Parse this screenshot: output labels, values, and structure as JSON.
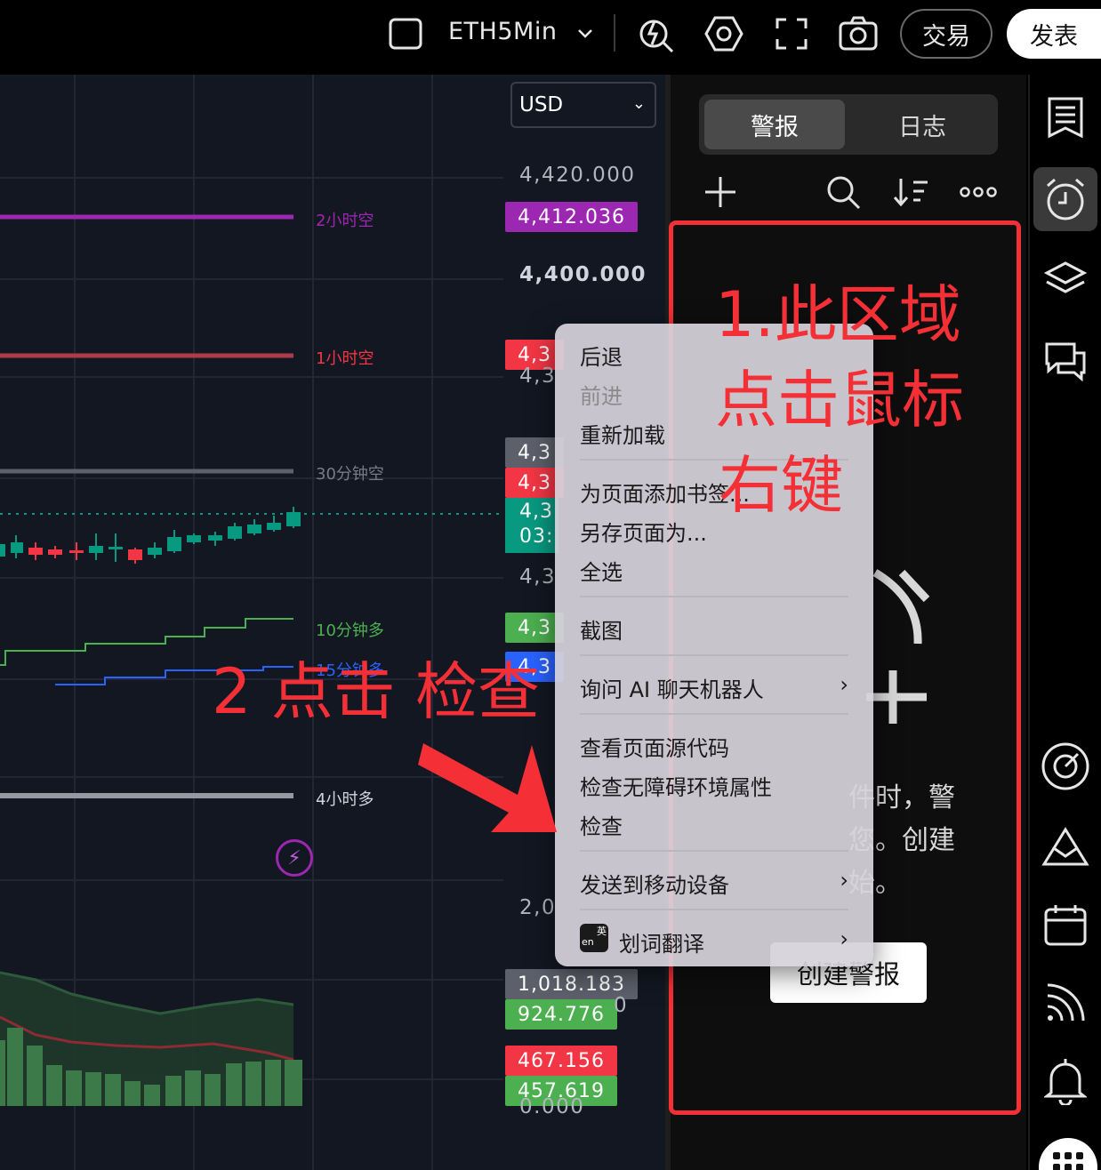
{
  "toolbar": {
    "symbol": "ETH5Min",
    "trade_label": "交易",
    "publish_label": "发表"
  },
  "chart": {
    "currency": "USD",
    "axis_ticks": {
      "t1": "4,420.000",
      "t2": "4,400.000",
      "t3": "4,3",
      "t4": "4,3",
      "t5": "2,0",
      "t6": "0",
      "t7": "0.000"
    },
    "price_tags": {
      "p_2h_short": "4,412.036",
      "p_1h_short": "4,3",
      "p_30m_short": "4,3",
      "p_red2": "4,3",
      "p_last": "4,3",
      "p_last_time": "03:",
      "p_10m_long": "4,3",
      "p_15m_long": "4,3",
      "v1": "1,018.183",
      "v2": "924.776",
      "v3": "467.156",
      "v4": "457.619"
    },
    "line_labels": {
      "h2_short": "2小时空",
      "h1_short": "1小时空",
      "m30_short": "30分钟空",
      "m10_long": "10分钟多",
      "m15_long": "15分钟多",
      "h4_long": "4小时多"
    },
    "colors": {
      "purple": "#9c27b0",
      "red": "#f23645",
      "green": "#4caf50",
      "blue": "#2962ff",
      "grey": "#787b86",
      "teal": "#089981"
    }
  },
  "alerts_panel": {
    "tab_alerts": "警报",
    "tab_log": "日志",
    "empty_text_l1": "件时，警",
    "empty_text_l2": "您。创建",
    "empty_text_l3": "始。",
    "create_button": "创建警报"
  },
  "context_menu": {
    "back": "后退",
    "forward": "前进",
    "reload": "重新加载",
    "bookmark": "为页面添加书签...",
    "save_as": "另存页面为...",
    "select_all": "全选",
    "screenshot": "截图",
    "ask_ai": "询问 AI 聊天机器人",
    "view_source": "查看页面源代码",
    "accessibility": "检查无障碍环境属性",
    "inspect": "检查",
    "send_mobile": "发送到移动设备",
    "translate": "划词翻译",
    "translate_badge_top": "英",
    "translate_badge_bottom": "en"
  },
  "annotations": {
    "step1_l1": "1.此区域",
    "step1_l2": "点击鼠标",
    "step1_l3": "右键",
    "step2": "2 点击 检查"
  },
  "icons": [
    "square-icon",
    "chevron-down-icon",
    "lightning-search-icon",
    "hexagon-settings-icon",
    "fullscreen-icon",
    "camera-icon",
    "plus-icon",
    "search-icon",
    "sort-icon",
    "more-icon",
    "watchlist-icon",
    "alarm-clock-icon",
    "layers-icon",
    "chat-icon",
    "target-icon",
    "mountain-icon",
    "calendar-icon",
    "broadcast-icon",
    "bell-icon",
    "apps-grid-icon"
  ]
}
